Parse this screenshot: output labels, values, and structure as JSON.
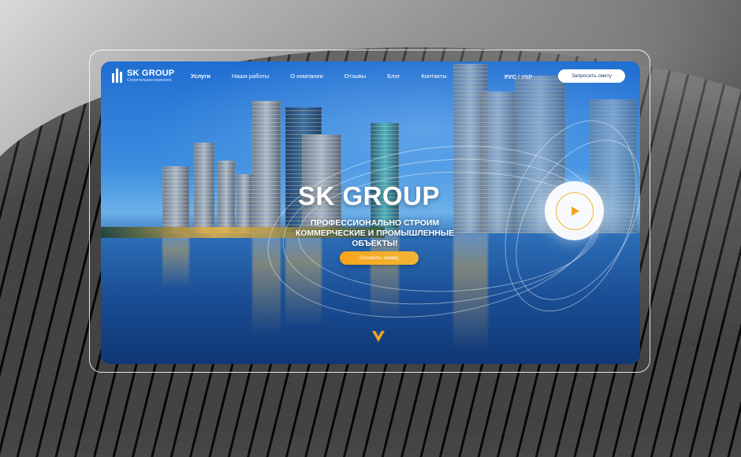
{
  "brand": {
    "name": "SK GROUP",
    "tagline": "Строительная компания"
  },
  "nav": {
    "items": [
      {
        "label": "Услуги"
      },
      {
        "label": "Наши работы"
      },
      {
        "label": "О компании"
      },
      {
        "label": "Отзывы"
      },
      {
        "label": "Блог"
      },
      {
        "label": "Контакты"
      }
    ],
    "active_index": 0
  },
  "language": {
    "current": "РУС",
    "separator": " / ",
    "other": "УКР"
  },
  "header_cta": {
    "label": "Запросить смету"
  },
  "hero": {
    "title": "SK GROUP",
    "subtitle": "ПРОФЕССИОНАЛЬНО СТРОИМ КОММЕРЧЕСКИЕ И ПРОМЫШЛЕННЫЕ ОБЪЕКТЫ!",
    "cta_label": "Оставить заявку"
  },
  "icons": {
    "play": "play-icon",
    "scroll": "chevron-down-icon",
    "logo": "building-logo-icon"
  },
  "colors": {
    "accent": "#F3A520",
    "primary": "#1F6ED1",
    "text": "#FFFFFF"
  }
}
